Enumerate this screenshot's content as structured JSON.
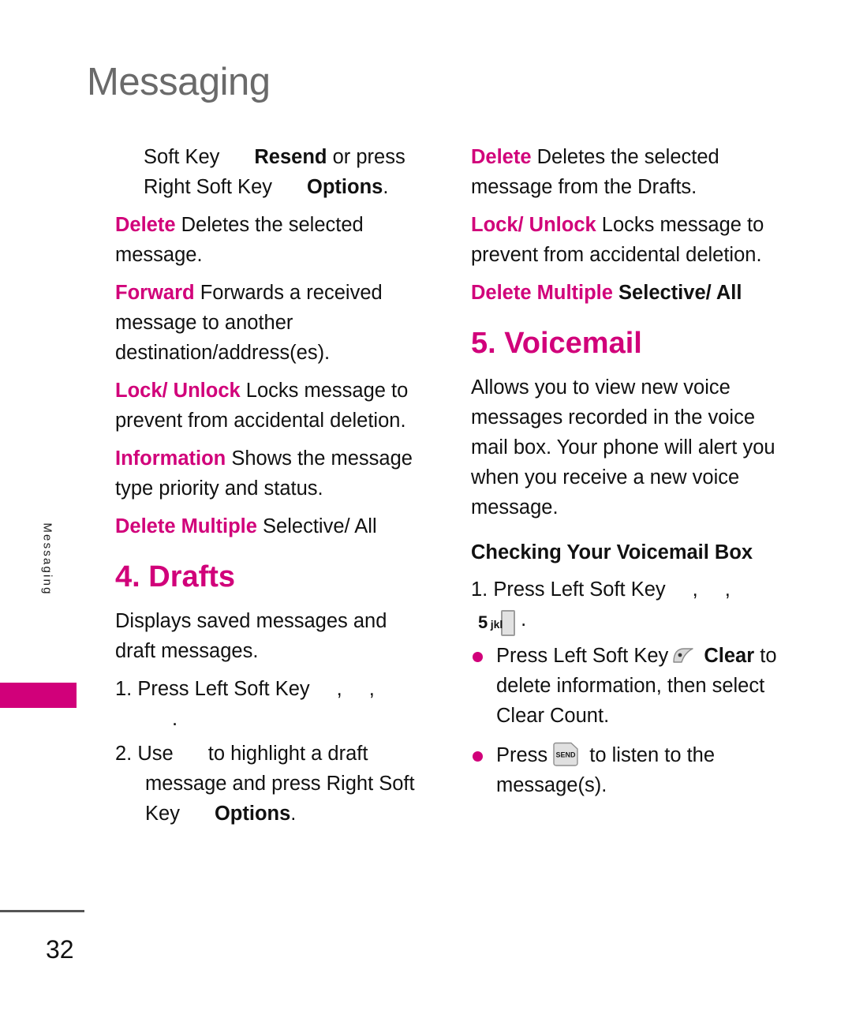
{
  "page": {
    "title": "Messaging",
    "side_tab_label": "Messaging",
    "page_number": "32",
    "accent_color": "#d1007a",
    "title_color": "#6a6a6a"
  },
  "left_column": {
    "continued_entry": {
      "line1_pre": "Soft Key",
      "line1_bold": "Resend",
      "line1_post": " or press",
      "line2_pre": "Right Soft Key",
      "line2_bold": "Options",
      "line2_post": "."
    },
    "items": [
      {
        "term": "Delete",
        "desc": "Deletes the selected message."
      },
      {
        "term": "Forward",
        "desc": "Forwards a received message to another destination/address(es)."
      },
      {
        "term": "Lock/ Unlock",
        "desc": "Locks message to prevent from accidental deletion."
      },
      {
        "term": "Information",
        "desc": "Shows the message type priority and status."
      },
      {
        "term": "Delete Multiple",
        "desc": "Selective/ All",
        "desc_bold": false
      }
    ],
    "section": {
      "heading": "4. Drafts",
      "body": "Displays saved messages and draft messages.",
      "steps": [
        {
          "number": "1.",
          "text_pre": "Press Left Soft Key",
          "text_mid": ",",
          "text_mid2": ",",
          "text_post": "."
        },
        {
          "number": "2.",
          "text_pre": "Use",
          "text_mid": "to highlight a draft message and press Right Soft Key",
          "bold": "Options",
          "text_post": "."
        }
      ]
    }
  },
  "right_column": {
    "items": [
      {
        "term": "Delete",
        "desc": "Deletes the selected message from the Drafts."
      },
      {
        "term": "Lock/ Unlock",
        "desc": "Locks message to prevent from accidental deletion."
      },
      {
        "term": "Delete Multiple",
        "desc": "Selective/ All",
        "desc_bold": true
      }
    ],
    "section": {
      "heading": "5. Voicemail",
      "body": "Allows you to view new voice messages recorded in the voice mail box. Your phone will alert you when you receive a new voice message.",
      "sub_heading": "Checking Your Voicemail Box",
      "step": {
        "number": "1.",
        "text_pre": "Press Left Soft Key",
        "comma1": ",",
        "comma2": ",",
        "key_number": "5",
        "key_letters": "jkl",
        "text_post": "."
      },
      "bullets": [
        {
          "text_pre": "Press Left Soft Key",
          "bold": "Clear",
          "text_post": "to delete information, then select Clear Count.",
          "icon": "soft-key-icon"
        },
        {
          "text_pre": "Press",
          "key_label": "SEND",
          "text_post": "to listen to the message(s).",
          "icon": "send-key-icon"
        }
      ]
    }
  }
}
